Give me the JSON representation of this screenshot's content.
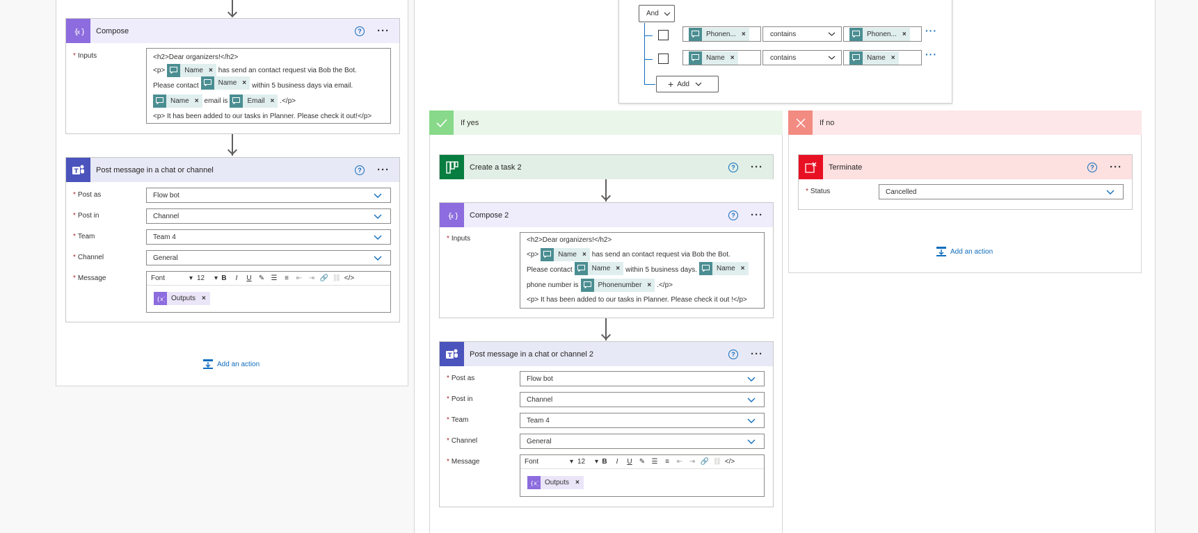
{
  "left_branch": {
    "compose": {
      "title": "Compose",
      "inputs_label": "Inputs",
      "line1": "<h2>Dear organizers!</h2>",
      "line2_pre": "<p>",
      "line2_token": "Name",
      "line2_post": "has send an contact request via Bob the Bot.",
      "line3_pre": "Please contact",
      "line3_token": "Name",
      "line3_post": "within 5 business days via email.",
      "line4_token1": "Name",
      "line4_mid": "email is",
      "line4_token2": "Email",
      "line4_post": ".</p>",
      "line5": "<p> It has been added to our tasks in Planner. Please check it out!</p>"
    },
    "post": {
      "title": "Post message in a chat or channel",
      "post_as_label": "Post as",
      "post_as_value": "Flow bot",
      "post_in_label": "Post in",
      "post_in_value": "Channel",
      "team_label": "Team",
      "team_value": "Team 4",
      "channel_label": "Channel",
      "channel_value": "General",
      "message_label": "Message",
      "font": "Font",
      "size": "12",
      "outputs": "Outputs"
    },
    "add_action": "Add an action"
  },
  "condition": {
    "and_label": "And",
    "row1_left": "Phonen...",
    "row1_op": "contains",
    "row1_right": "Phonen...",
    "row2_left": "Name",
    "row2_op": "contains",
    "row2_right": "Name",
    "add_label": "Add"
  },
  "if_yes": {
    "label": "If yes",
    "create_task": "Create a task 2",
    "compose": {
      "title": "Compose 2",
      "inputs_label": "Inputs",
      "line1": "<h2>Dear organizers!</h2>",
      "line2_pre": "<p>",
      "line2_token": "Name",
      "line2_post": "has send an contact request via Bob the Bot.",
      "line3_pre": "Please contact",
      "line3_token": "Name",
      "line3_mid": "within 5 business days.",
      "line3_token2": "Name",
      "line4_pre": "phone number is",
      "line4_token": "Phonenumber",
      "line4_post": ".</p>",
      "line5": "<p> It has been added to our tasks in Planner. Please check it out !</p>"
    },
    "post": {
      "title": "Post message in a chat or channel 2",
      "post_as_label": "Post as",
      "post_as_value": "Flow bot",
      "post_in_label": "Post in",
      "post_in_value": "Channel",
      "team_label": "Team",
      "team_value": "Team 4",
      "channel_label": "Channel",
      "channel_value": "General",
      "message_label": "Message",
      "font": "Font",
      "size": "12",
      "outputs": "Outputs"
    }
  },
  "if_no": {
    "label": "If no",
    "terminate": "Terminate",
    "status_label": "Status",
    "status_value": "Cancelled",
    "add_action": "Add an action"
  },
  "colors": {
    "compose": "#8c6cde",
    "teams": "#4b53bc",
    "planner": "#077d3f",
    "terminate": "#e81123",
    "yes": "#88d989",
    "no": "#f28b82",
    "link": "#0f6cbd"
  }
}
